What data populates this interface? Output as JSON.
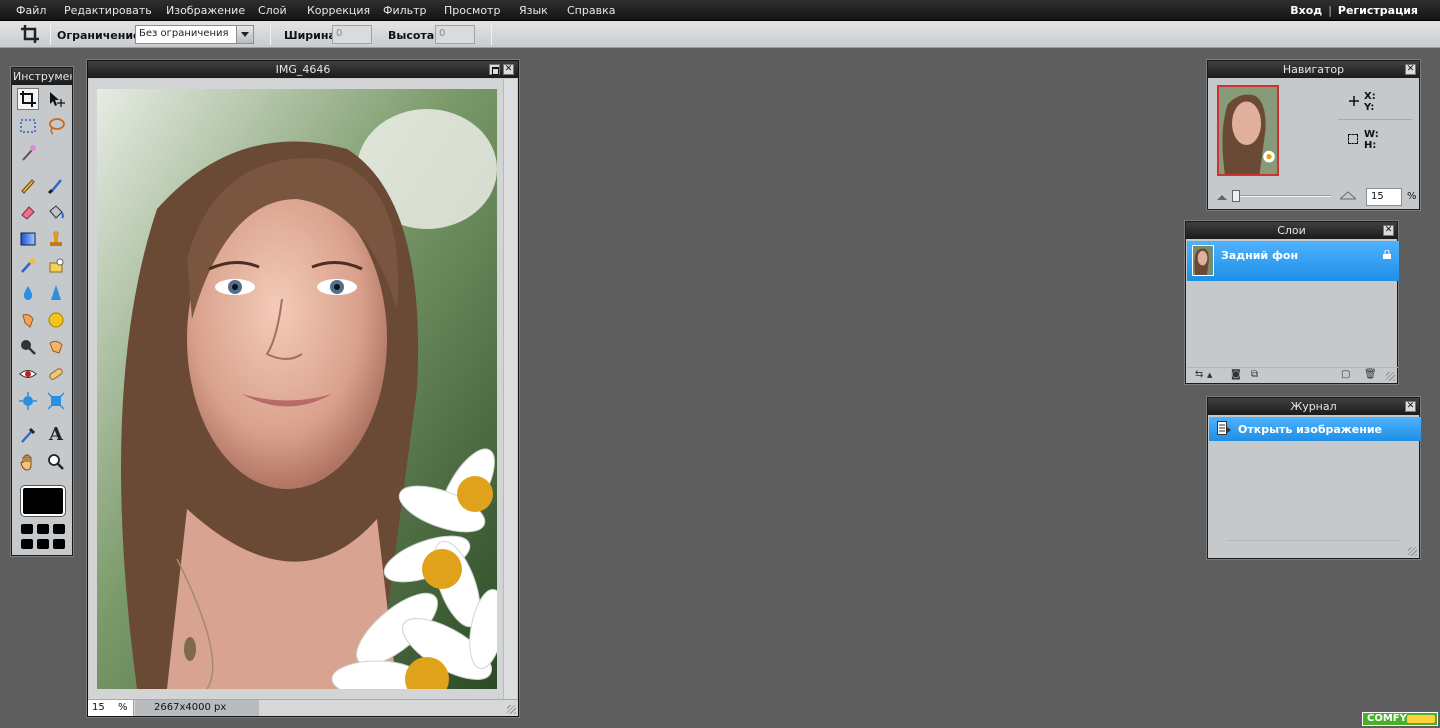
{
  "menubar": {
    "items": [
      {
        "label": "Файл"
      },
      {
        "label": "Редактировать"
      },
      {
        "label": "Изображение"
      },
      {
        "label": "Слой"
      },
      {
        "label": "Коррекция"
      },
      {
        "label": "Фильтр"
      },
      {
        "label": "Просмотр"
      },
      {
        "label": "Язык"
      },
      {
        "label": "Справка"
      }
    ],
    "login": "Вход",
    "separator": "|",
    "register": "Регистрация"
  },
  "options": {
    "constraint_label": "Ограничение:",
    "constraint_value": "Без ограничения",
    "width_label": "Ширина:",
    "width_value": "0",
    "height_label": "Высота:",
    "height_value": "0"
  },
  "tools_panel": {
    "title": "Инструменты",
    "primary_color": "#000000",
    "active_tool": "crop-tool"
  },
  "image_window": {
    "title": "IMG_4646",
    "zoom_value": "15",
    "zoom_unit": "%",
    "dimensions": "2667x4000 px"
  },
  "navigator": {
    "title": "Навигатор",
    "x_label": "X:",
    "y_label": "Y:",
    "w_label": "W:",
    "h_label": "H:",
    "zoom_value": "15",
    "zoom_unit": "%"
  },
  "layers": {
    "title": "Слои",
    "items": [
      {
        "name": "Задний фон",
        "locked": true,
        "selected": true
      }
    ]
  },
  "history": {
    "title": "Журнал",
    "items": [
      {
        "label": "Открыть изображение",
        "selected": true
      }
    ]
  },
  "badge": {
    "label": "COMFY"
  },
  "colors": {
    "accent": "#2ea0f5",
    "panel": "#c5c9cc",
    "workspace": "#5e5e5e"
  }
}
